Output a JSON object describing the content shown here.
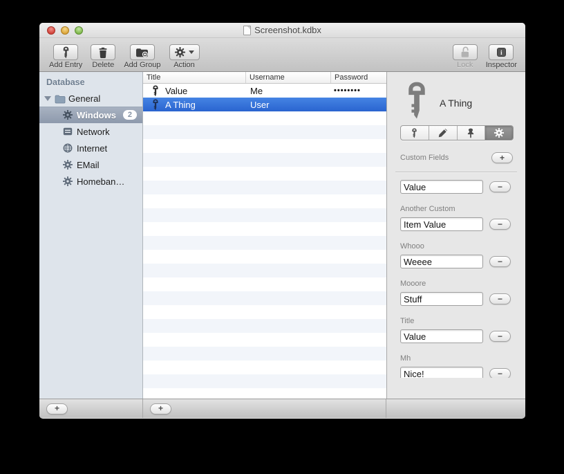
{
  "window": {
    "title": "Screenshot.kdbx"
  },
  "toolbar": {
    "left_buttons": [
      {
        "label": "Add Entry",
        "icon": "key"
      },
      {
        "label": "Delete",
        "icon": "trash"
      },
      {
        "label": "Add Group",
        "icon": "folder-plus"
      },
      {
        "label": "Action",
        "icon": "gear",
        "has_dropdown": true
      }
    ],
    "right_buttons": [
      {
        "label": "Lock",
        "icon": "padlock-open",
        "disabled": true
      },
      {
        "label": "Inspector",
        "icon": "info-square"
      }
    ]
  },
  "sidebar": {
    "header": "Database",
    "group": {
      "label": "General",
      "icon": "folder",
      "expanded": true
    },
    "items": [
      {
        "label": "Windows",
        "icon": "gear",
        "badge": "2",
        "selected": true
      },
      {
        "label": "Network",
        "icon": "server",
        "badge": "",
        "selected": false
      },
      {
        "label": "Internet",
        "icon": "globe",
        "badge": "",
        "selected": false
      },
      {
        "label": "EMail",
        "icon": "gear",
        "badge": "",
        "selected": false
      },
      {
        "label": "Homeban…",
        "icon": "gear",
        "badge": "",
        "selected": false
      }
    ],
    "add_button": "+"
  },
  "entry_table": {
    "columns": [
      "Title",
      "Username",
      "Password"
    ],
    "rows": [
      {
        "title": "Value",
        "username": "Me",
        "password": "••••••••",
        "selected": false
      },
      {
        "title": "A Thing",
        "username": "User",
        "password": "",
        "selected": true
      }
    ],
    "add_button": "+"
  },
  "inspector": {
    "entry_title": "A Thing",
    "entry_icon": "key",
    "tabs": [
      {
        "icon": "key",
        "selected": false
      },
      {
        "icon": "pencil",
        "selected": false
      },
      {
        "icon": "pushpin",
        "selected": false
      },
      {
        "icon": "gear",
        "selected": true
      }
    ],
    "section_label": "Custom Fields",
    "add_button": "+",
    "fields": [
      {
        "label": "",
        "value": "Value",
        "remove_button": "−"
      },
      {
        "label": "Another Custom",
        "value": "Item Value",
        "remove_button": "−"
      },
      {
        "label": "Whooo",
        "value": "Weeee",
        "remove_button": "−"
      },
      {
        "label": "Mooore",
        "value": "Stuff",
        "remove_button": "−"
      },
      {
        "label": "Title",
        "value": "Value",
        "remove_button": "−"
      },
      {
        "label": "Mh",
        "value": "Nice!",
        "remove_button": "−"
      }
    ]
  },
  "colors": {
    "selection_blue": "#2f6fd8",
    "sidebar_selection": "#98a4b4",
    "sidebar_bg": "#dee4eb",
    "row_alternate": "#f2f5fa",
    "inspector_bg": "#e7e7e7"
  }
}
